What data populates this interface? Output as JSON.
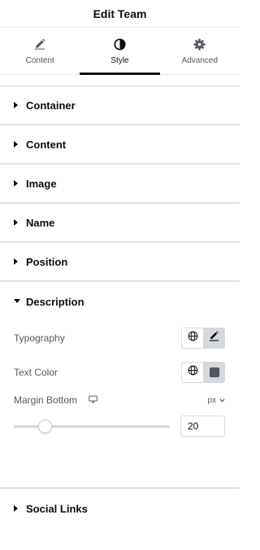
{
  "header": {
    "title": "Edit Team"
  },
  "tabs": [
    {
      "label": "Content",
      "icon": "pencil-icon",
      "active": false
    },
    {
      "label": "Style",
      "icon": "contrast-icon",
      "active": true
    },
    {
      "label": "Advanced",
      "icon": "gear-icon",
      "active": false
    }
  ],
  "sections": {
    "container": "Container",
    "content": "Content",
    "image": "Image",
    "name": "Name",
    "position": "Position",
    "description": "Description",
    "social_links": "Social Links"
  },
  "description_controls": {
    "typography_label": "Typography",
    "text_color_label": "Text Color",
    "margin_bottom_label": "Margin Bottom",
    "margin_unit": "px",
    "margin_value": "20",
    "slider_fraction": 0.2
  },
  "colors": {
    "text": "#0c0d0e",
    "muted": "#515962",
    "border": "#d5d8dc",
    "swatch": "#515962"
  }
}
